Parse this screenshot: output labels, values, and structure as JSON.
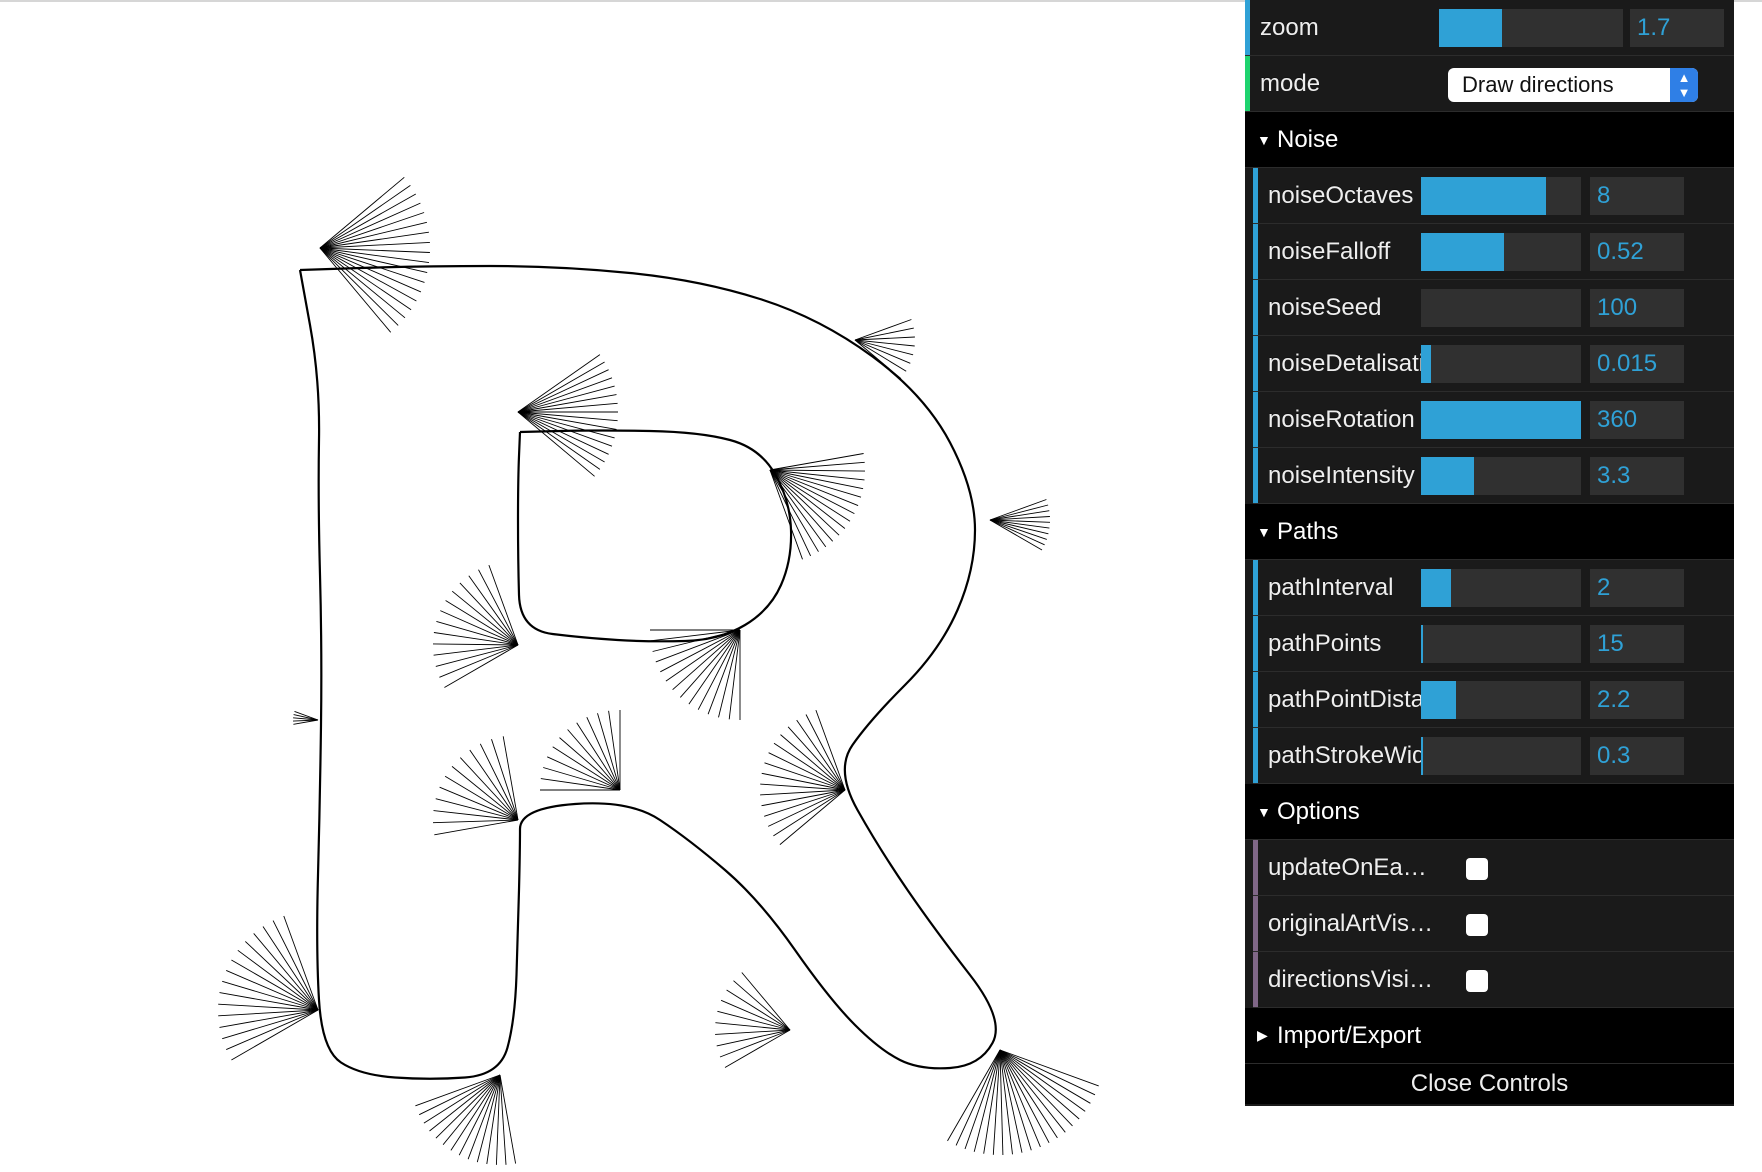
{
  "gui": {
    "zoom": {
      "label": "zoom",
      "value": "1.7",
      "fill": 0.34
    },
    "mode": {
      "label": "mode",
      "selected": "Draw directions"
    },
    "noise": {
      "title": "Noise",
      "items": [
        {
          "label": "noiseOctaves",
          "value": "8",
          "fill": 0.78
        },
        {
          "label": "noiseFalloff",
          "value": "0.52",
          "fill": 0.52
        },
        {
          "label": "noiseSeed",
          "value": "100",
          "fill": 0.0
        },
        {
          "label": "noiseDetalisati...",
          "value": "0.015",
          "fill": 0.06
        },
        {
          "label": "noiseRotation",
          "value": "360",
          "fill": 1.0
        },
        {
          "label": "noiseIntensity",
          "value": "3.3",
          "fill": 0.33
        }
      ]
    },
    "paths": {
      "title": "Paths",
      "items": [
        {
          "label": "pathInterval",
          "value": "2",
          "fill": 0.19
        },
        {
          "label": "pathPoints",
          "value": "15",
          "fill": 0.01
        },
        {
          "label": "pathPointDista...",
          "value": "2.2",
          "fill": 0.22
        },
        {
          "label": "pathStrokeWidth",
          "value": "0.3",
          "fill": 0.01
        }
      ]
    },
    "options": {
      "title": "Options",
      "items": [
        {
          "label": "updateOnEach...",
          "checked": false
        },
        {
          "label": "originalArtVisib...",
          "checked": false
        },
        {
          "label": "directionsVisible",
          "checked": false
        }
      ]
    },
    "import_export": {
      "title": "Import/Export"
    },
    "close_label": "Close Controls"
  },
  "colors": {
    "slider_fill": "#2fa1d6",
    "panel_bg": "#1a1a1a",
    "folder_bg": "#000000"
  }
}
